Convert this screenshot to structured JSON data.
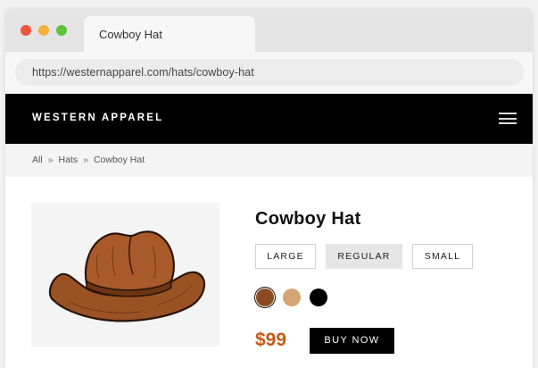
{
  "browser": {
    "tab_title": "Cowboy Hat",
    "url": "https://westernapparel.com/hats/cowboy-hat",
    "traffic_lights": {
      "close": "#f0543f",
      "minimize": "#f6b03b",
      "maximize": "#61c23e"
    }
  },
  "site": {
    "brand": "WESTERN APPAREL",
    "menu_icon": "hamburger-menu-icon"
  },
  "breadcrumb": {
    "separator": "»",
    "items": [
      "All",
      "Hats",
      "Cowboy Hat"
    ]
  },
  "product": {
    "title": "Cowboy Hat",
    "image_alt_icon": "cowboy-hat-image",
    "sizes": [
      {
        "label": "LARGE",
        "selected": false
      },
      {
        "label": "REGULAR",
        "selected": true
      },
      {
        "label": "SMALL",
        "selected": false
      }
    ],
    "colors": [
      {
        "hex": "#8b4a1f",
        "selected": true
      },
      {
        "hex": "#d4a574",
        "selected": false
      },
      {
        "hex": "#000000",
        "selected": false
      }
    ],
    "price": "$99",
    "price_color": "#c25a17",
    "buy_label": "BUY NOW"
  }
}
